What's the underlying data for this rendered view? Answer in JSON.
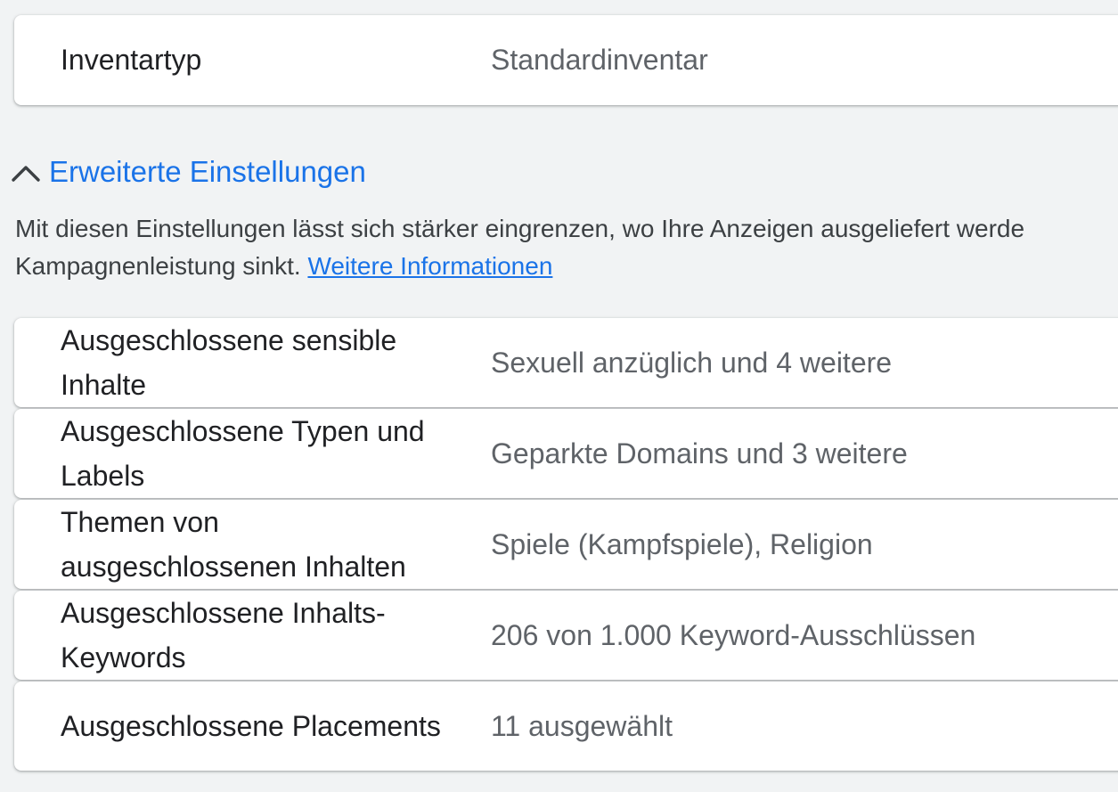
{
  "inventory": {
    "label": "Inventartyp",
    "value": "Standardinventar"
  },
  "advanced": {
    "title": "Erweiterte Einstellungen",
    "description_line1": "Mit diesen Einstellungen lässt sich stärker eingrenzen, wo Ihre Anzeigen ausgeliefert werde",
    "description_line2": "Kampagnenleistung sinkt.",
    "learn_more": "Weitere Informationen"
  },
  "settings": [
    {
      "label": "Ausgeschlossene sensible Inhalte",
      "value": "Sexuell anzüglich und 4 weitere"
    },
    {
      "label": "Ausgeschlossene Typen und Labels",
      "value": "Geparkte Domains und 3 weitere"
    },
    {
      "label": "Themen von ausgeschlossenen Inhalten",
      "value": "Spiele (Kampfspiele), Religion"
    },
    {
      "label": "Ausgeschlossene Inhalts-Keywords",
      "value": "206 von 1.000 Keyword-Ausschlüssen"
    },
    {
      "label": "Ausgeschlossene Placements",
      "value": "11 ausgewählt"
    }
  ],
  "colors": {
    "link": "#1a73e8",
    "label": "#202124",
    "value": "#5f6368",
    "background": "#f1f3f4"
  },
  "icons": {
    "collapse": "chevron-up-icon"
  }
}
